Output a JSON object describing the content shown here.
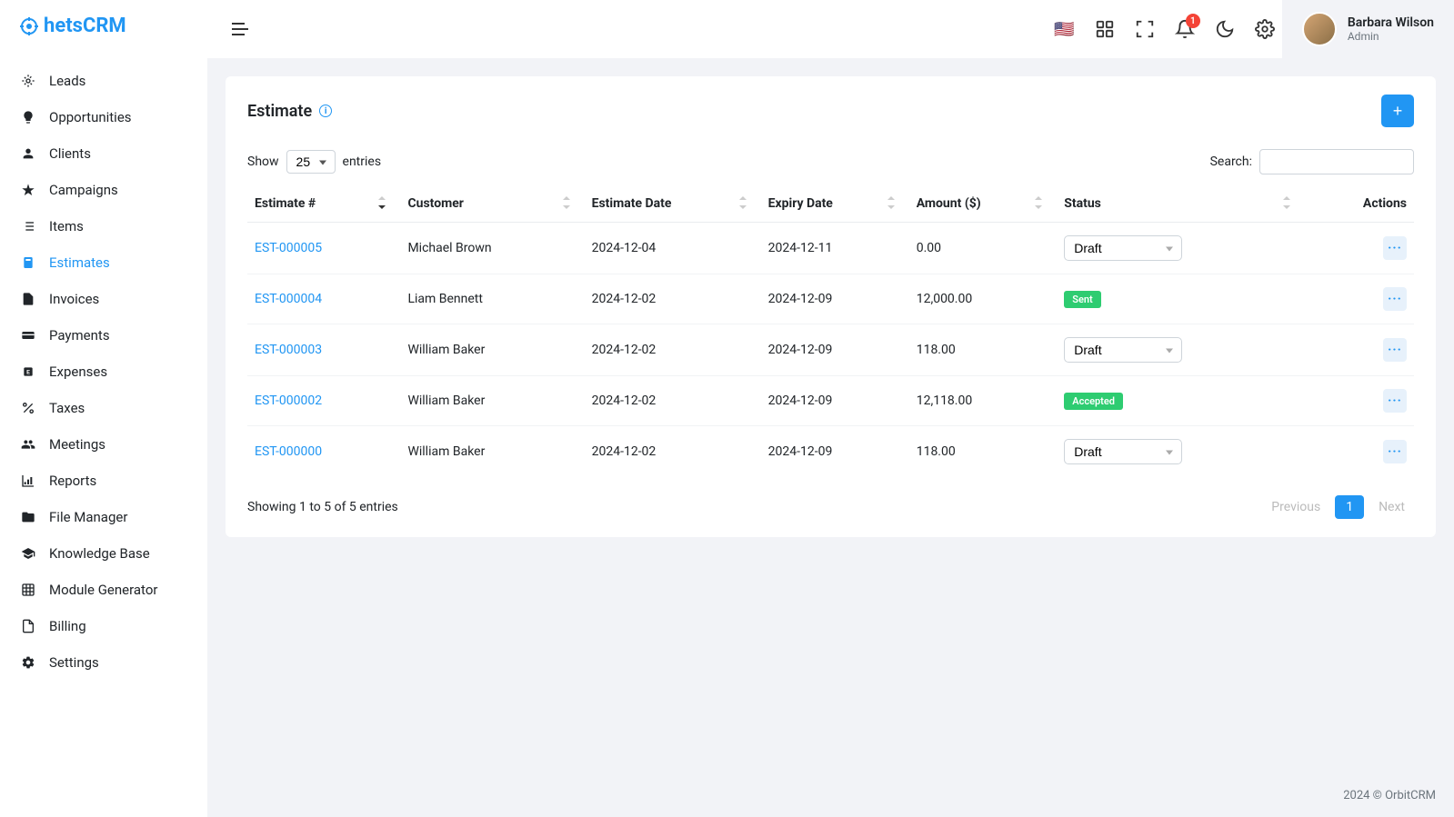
{
  "brand": {
    "name": "hetsCRM"
  },
  "header": {
    "notification_count": "1",
    "user": {
      "name": "Barbara Wilson",
      "role": "Admin"
    }
  },
  "sidebar": {
    "items": [
      {
        "label": "Leads"
      },
      {
        "label": "Opportunities"
      },
      {
        "label": "Clients"
      },
      {
        "label": "Campaigns"
      },
      {
        "label": "Items"
      },
      {
        "label": "Estimates"
      },
      {
        "label": "Invoices"
      },
      {
        "label": "Payments"
      },
      {
        "label": "Expenses"
      },
      {
        "label": "Taxes"
      },
      {
        "label": "Meetings"
      },
      {
        "label": "Reports"
      },
      {
        "label": "File Manager"
      },
      {
        "label": "Knowledge Base"
      },
      {
        "label": "Module Generator"
      },
      {
        "label": "Billing"
      },
      {
        "label": "Settings"
      }
    ]
  },
  "page": {
    "title": "Estimate",
    "show_label": "Show",
    "entries_label": "entries",
    "entries_value": "25",
    "search_label": "Search:",
    "columns": {
      "estimate_no": "Estimate #",
      "customer": "Customer",
      "estimate_date": "Estimate Date",
      "expiry_date": "Expiry Date",
      "amount": "Amount ($)",
      "status": "Status",
      "actions": "Actions"
    },
    "rows": [
      {
        "no": "EST-000005",
        "customer": "Michael Brown",
        "date": "2024-12-04",
        "expiry": "2024-12-11",
        "amount": "0.00",
        "status_type": "select",
        "status": "Draft"
      },
      {
        "no": "EST-000004",
        "customer": "Liam Bennett",
        "date": "2024-12-02",
        "expiry": "2024-12-09",
        "amount": "12,000.00",
        "status_type": "badge",
        "status": "Sent"
      },
      {
        "no": "EST-000003",
        "customer": "William Baker",
        "date": "2024-12-02",
        "expiry": "2024-12-09",
        "amount": "118.00",
        "status_type": "select",
        "status": "Draft"
      },
      {
        "no": "EST-000002",
        "customer": "William Baker",
        "date": "2024-12-02",
        "expiry": "2024-12-09",
        "amount": "12,118.00",
        "status_type": "badge",
        "status": "Accepted"
      },
      {
        "no": "EST-000000",
        "customer": "William Baker",
        "date": "2024-12-02",
        "expiry": "2024-12-09",
        "amount": "118.00",
        "status_type": "select",
        "status": "Draft"
      }
    ],
    "footer_info": "Showing 1 to 5 of 5 entries",
    "pagination": {
      "previous": "Previous",
      "current": "1",
      "next": "Next"
    }
  },
  "footer": {
    "text": "2024 © OrbitCRM"
  }
}
